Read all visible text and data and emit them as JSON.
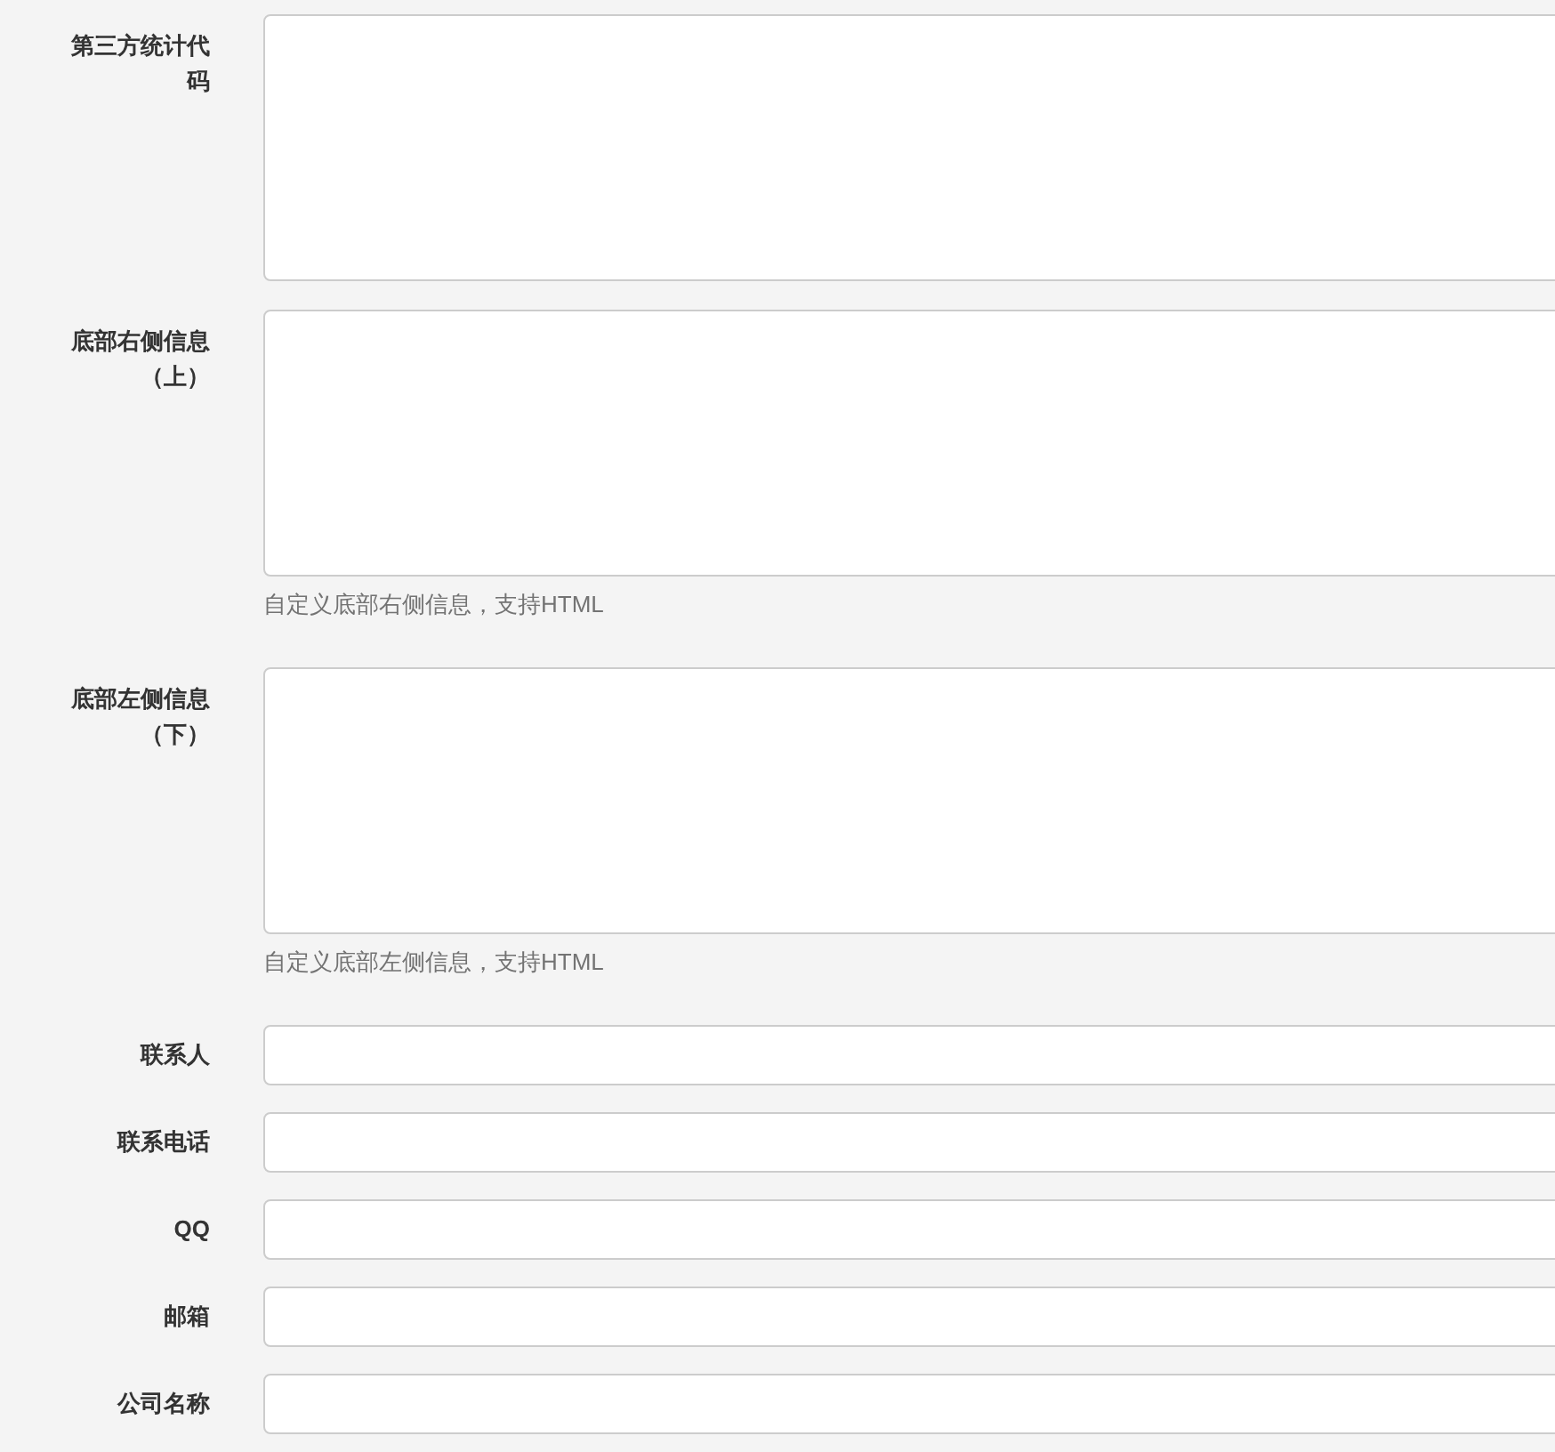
{
  "fields": [
    {
      "label": "第三方统计代码",
      "kind": "textarea"
    },
    {
      "label": "底部右侧信息（上）",
      "kind": "textarea",
      "help": "自定义底部右侧信息，支持HTML"
    },
    {
      "label": "底部左侧信息（下）",
      "kind": "textarea",
      "help": "自定义底部左侧信息，支持HTML"
    },
    {
      "label": "联系人",
      "kind": "input"
    },
    {
      "label": "联系电话",
      "kind": "input"
    },
    {
      "label": "QQ",
      "kind": "input"
    },
    {
      "label": "邮箱",
      "kind": "input"
    },
    {
      "label": "公司名称",
      "kind": "input"
    }
  ]
}
